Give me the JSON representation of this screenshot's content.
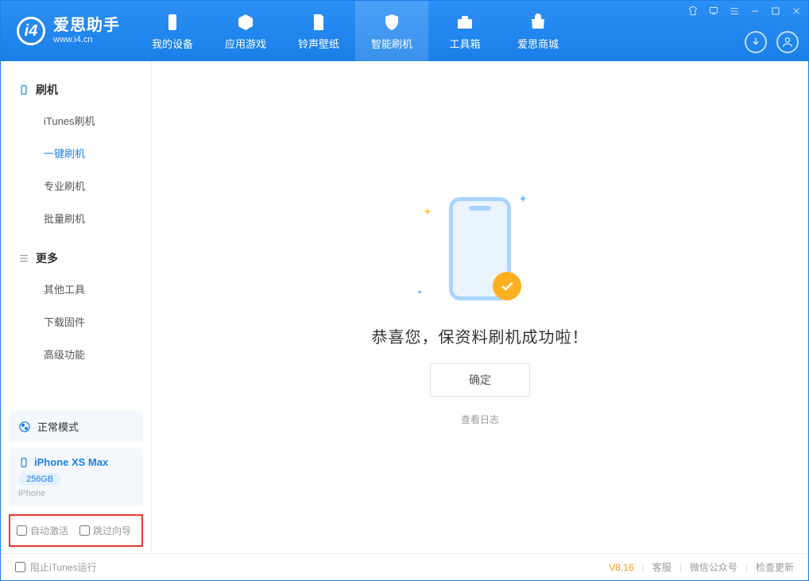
{
  "app": {
    "title": "爱思助手",
    "subtitle": "www.i4.cn"
  },
  "nav": {
    "items": [
      {
        "label": "我的设备"
      },
      {
        "label": "应用游戏"
      },
      {
        "label": "铃声壁纸"
      },
      {
        "label": "智能刷机"
      },
      {
        "label": "工具箱"
      },
      {
        "label": "爱思商城"
      }
    ]
  },
  "sidebar": {
    "sec1": {
      "title": "刷机",
      "items": [
        "iTunes刷机",
        "一键刷机",
        "专业刷机",
        "批量刷机"
      ]
    },
    "sec2": {
      "title": "更多",
      "items": [
        "其他工具",
        "下载固件",
        "高级功能"
      ]
    },
    "status": "正常模式",
    "device": {
      "name": "iPhone XS Max",
      "storage": "256GB",
      "type": "iPhone"
    },
    "checks": {
      "auto_activate": "自动激活",
      "skip_guide": "跳过向导"
    }
  },
  "main": {
    "success_text": "恭喜您，保资料刷机成功啦！",
    "ok_label": "确定",
    "log_label": "查看日志"
  },
  "footer": {
    "stop_itunes": "阻止iTunes运行",
    "version": "V8.16",
    "support": "客服",
    "wechat": "微信公众号",
    "update": "检查更新"
  }
}
